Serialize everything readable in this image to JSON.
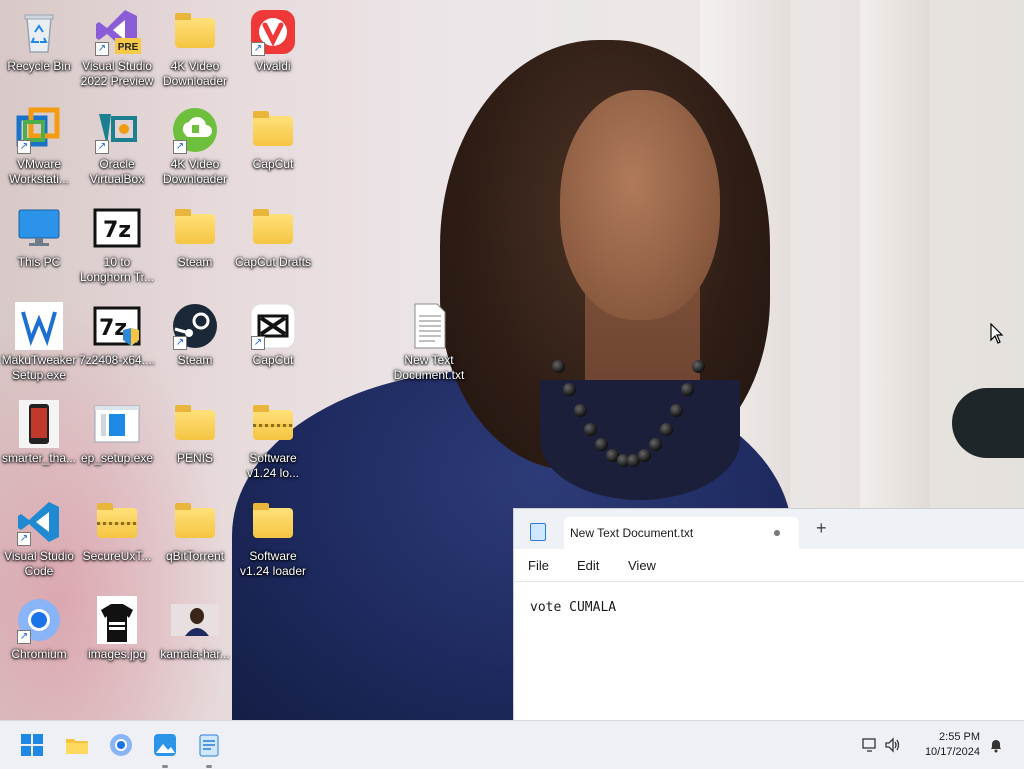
{
  "desktop_icons": [
    {
      "label": "Recycle Bin",
      "icon": "recycle-bin-icon"
    },
    {
      "label": "Visual Studio\n2022 Preview",
      "icon": "visual-studio-preview-icon",
      "badge": "PRE"
    },
    {
      "label": "4K Video\nDownloader",
      "icon": "folder-icon"
    },
    {
      "label": "Vivaldi",
      "icon": "vivaldi-icon"
    },
    {
      "label": "VMware\nWorkstati...",
      "icon": "vmware-icon"
    },
    {
      "label": "Oracle\nVirtualBox",
      "icon": "virtualbox-icon"
    },
    {
      "label": "4K Video\nDownloader",
      "icon": "4k-video-downloader-icon"
    },
    {
      "label": "CapCut",
      "icon": "folder-icon"
    },
    {
      "label": "This PC",
      "icon": "monitor-icon"
    },
    {
      "label": "10 to\nLonghorn Tr...",
      "icon": "7zip-icon"
    },
    {
      "label": "Steam",
      "icon": "folder-icon"
    },
    {
      "label": "CapCut Drafts",
      "icon": "folder-icon"
    },
    {
      "label": "MakuTweaker\nSetup.exe",
      "icon": "makutweaker-icon"
    },
    {
      "label": "7z2408-x64....",
      "icon": "7zip-installer-icon"
    },
    {
      "label": "Steam",
      "icon": "steam-icon"
    },
    {
      "label": "CapCut",
      "icon": "capcut-icon"
    },
    {
      "label": "smarter_tha...",
      "icon": "phone-image-icon"
    },
    {
      "label": "ep_setup.exe",
      "icon": "ep-setup-icon"
    },
    {
      "label": "PENIS",
      "icon": "folder-icon"
    },
    {
      "label": "Software\nv1.24 lo...",
      "icon": "zip-folder-icon"
    },
    {
      "label": "Visual Studio\nCode",
      "icon": "vscode-icon"
    },
    {
      "label": "SecureUxT...",
      "icon": "zip-folder-icon"
    },
    {
      "label": "qBitTorrent",
      "icon": "folder-icon"
    },
    {
      "label": "Software\nv1.24 loader",
      "icon": "folder-icon"
    },
    {
      "label": "Chromium",
      "icon": "chromium-icon"
    },
    {
      "label": "images.jpg",
      "icon": "image-thumbnail-icon"
    },
    {
      "label": "kamala-har...",
      "icon": "image-thumbnail-icon"
    },
    {
      "label": "New Text\nDocument.txt",
      "icon": "text-file-icon"
    }
  ],
  "notepad": {
    "tab_title": "New Text Document.txt",
    "new_tab": "+",
    "menu": {
      "file": "File",
      "edit": "Edit",
      "view": "View"
    },
    "content": "vote CUMALA"
  },
  "taskbar": {
    "apps": [
      "windows-start-icon",
      "file-explorer-icon",
      "chromium-icon",
      "photos-icon",
      "notepad-icon"
    ],
    "time": "2:55 PM",
    "date": "10/17/2024"
  },
  "colors": {
    "taskbar_bg": "#eef0f5",
    "notepad_tab_bar": "#eef1f5",
    "folder_yellow": "#f5c542"
  }
}
